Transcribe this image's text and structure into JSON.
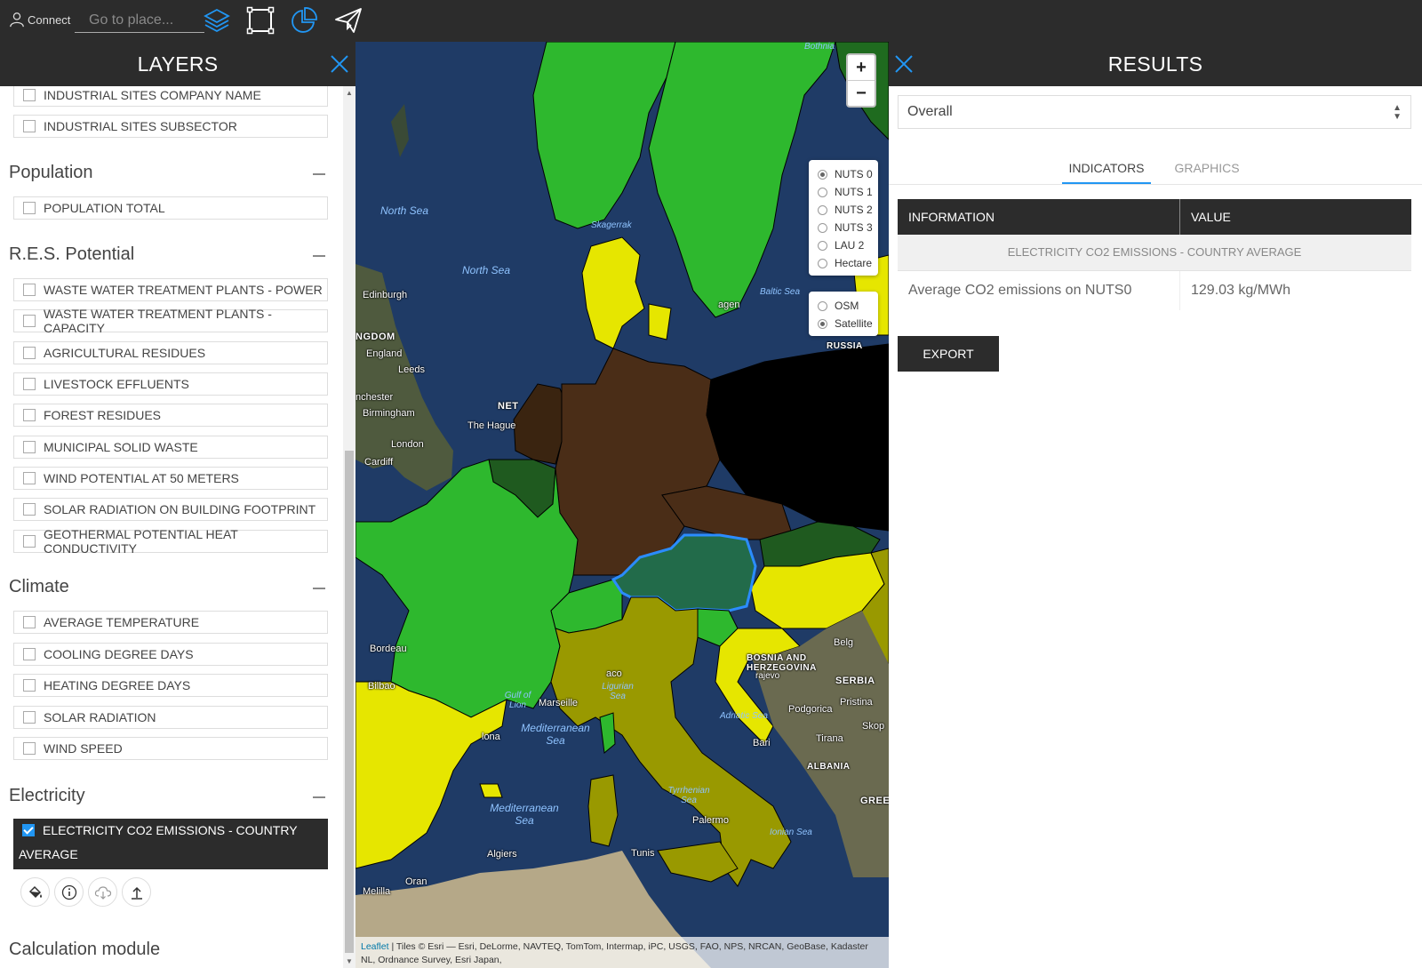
{
  "topbar": {
    "connect_label": "Connect",
    "search_placeholder": "Go to place...",
    "icons": [
      "user-icon",
      "layers-icon",
      "selection-rectangle-icon",
      "pie-chart-icon",
      "send-icon"
    ]
  },
  "layers_panel": {
    "title": "LAYERS",
    "items_top": [
      "INDUSTRIAL SITES COMPANY NAME",
      "INDUSTRIAL SITES SUBSECTOR"
    ],
    "sections": [
      {
        "title": "Population",
        "items": [
          "POPULATION TOTAL"
        ]
      },
      {
        "title": "R.E.S. Potential",
        "items": [
          "WASTE WATER TREATMENT PLANTS - POWER",
          "WASTE WATER TREATMENT PLANTS - CAPACITY",
          "AGRICULTURAL RESIDUES",
          "LIVESTOCK EFFLUENTS",
          "FOREST RESIDUES",
          "MUNICIPAL SOLID WASTE",
          "WIND POTENTIAL AT 50 METERS",
          "SOLAR RADIATION ON BUILDING FOOTPRINT",
          "GEOTHERMAL POTENTIAL HEAT CONDUCTIVITY"
        ]
      },
      {
        "title": "Climate",
        "items": [
          "AVERAGE TEMPERATURE",
          "COOLING DEGREE DAYS",
          "HEATING DEGREE DAYS",
          "SOLAR RADIATION",
          "WIND SPEED"
        ]
      },
      {
        "title": "Electricity",
        "items": []
      }
    ],
    "active_layer": {
      "line1": "ELECTRICITY CO2 EMISSIONS - COUNTRY",
      "line2": "AVERAGE",
      "checked": true
    },
    "layer_tools": [
      "paint-bucket-icon",
      "info-icon",
      "cloud-download-icon",
      "upload-icon"
    ],
    "next_section_partial": "Calculation module"
  },
  "map": {
    "zoom_in": "+",
    "zoom_out": "−",
    "levels": [
      {
        "label": "NUTS 0",
        "selected": true
      },
      {
        "label": "NUTS 1",
        "selected": false
      },
      {
        "label": "NUTS 2",
        "selected": false
      },
      {
        "label": "NUTS 3",
        "selected": false
      },
      {
        "label": "LAU 2",
        "selected": false
      },
      {
        "label": "Hectare",
        "selected": false
      }
    ],
    "basemaps": [
      {
        "label": "OSM",
        "selected": false
      },
      {
        "label": "Satellite",
        "selected": true
      }
    ],
    "attribution_link": "Leaflet",
    "attribution_text": " | Tiles © Esri — Esri, DeLorme, NAVTEQ, TomTom, Intermap, iPC, USGS, FAO, NPS, NRCAN, GeoBase, Kadaster NL, Ordnance Survey, Esri Japan,",
    "labels": {
      "bothnia": "Bothnia",
      "north_sea_1": "North Sea",
      "north_sea_2": "North Sea",
      "skagerrak": "Skagerrak",
      "baltic_sea": "Baltic Sea",
      "russia": "RUSSIA",
      "edinburgh": "Edinburgh",
      "kingdom": "NGDOM",
      "england": "England",
      "leeds": "Leeds",
      "manchester": "nchester",
      "birmingham": "Birmingham",
      "london": "London",
      "cardiff": "Cardiff",
      "the_hague": "The Hague",
      "neth": "NET",
      "copenhagen": "agen",
      "bordeaux": "Bordeau",
      "bilbao": "Bilbao",
      "gulf_lion": "Gulf of Lion",
      "marseille": "Marseille",
      "ligurian": "Ligurian Sea",
      "med_1": "Mediterranean Sea",
      "med_2": "Mediterranean Sea",
      "tyrrhenian": "Tyrrhenian Sea",
      "adriatic": "Adriatic Sea",
      "ionian": "Ionian Sea",
      "bosnia": "BOSNIA AND HERZEGOVINA",
      "serbia": "SERBIA",
      "albania": "ALBANIA",
      "podgorica": "Podgorica",
      "pristina": "Pristina",
      "tirana": "Tirana",
      "bari": "Bari",
      "palermo": "Palermo",
      "algiers": "Algiers",
      "tunis": "Tunis",
      "oran": "Oran",
      "melilla": "Melilla",
      "belg": "Belg",
      "sarajevo": "rajevo",
      "monaco": "aco",
      "barcelona": "lona",
      "greece": "GREE",
      "skopje": "Skop"
    }
  },
  "results_panel": {
    "title": "RESULTS",
    "select_value": "Overall",
    "tabs": [
      {
        "label": "INDICATORS",
        "active": true
      },
      {
        "label": "GRAPHICS",
        "active": false
      }
    ],
    "table": {
      "headers": [
        "INFORMATION",
        "VALUE"
      ],
      "group": "ELECTRICITY CO2 EMISSIONS - COUNTRY AVERAGE",
      "rows": [
        {
          "info": "Average CO2 emissions on NUTS0",
          "value": "129.03 kg/MWh"
        }
      ]
    },
    "export_label": "EXPORT"
  },
  "colors": {
    "bar_bg": "#2c2c2c",
    "accent": "#2196f3",
    "bright_green": "#2eb82e",
    "dark_brown": "#4a2d17",
    "yellow": "#e6e600",
    "olive": "#999900",
    "black": "#000000",
    "dark_green": "#1f5a1f",
    "austria_fill": "#226b4a",
    "austria_outline": "#2b8cff"
  }
}
